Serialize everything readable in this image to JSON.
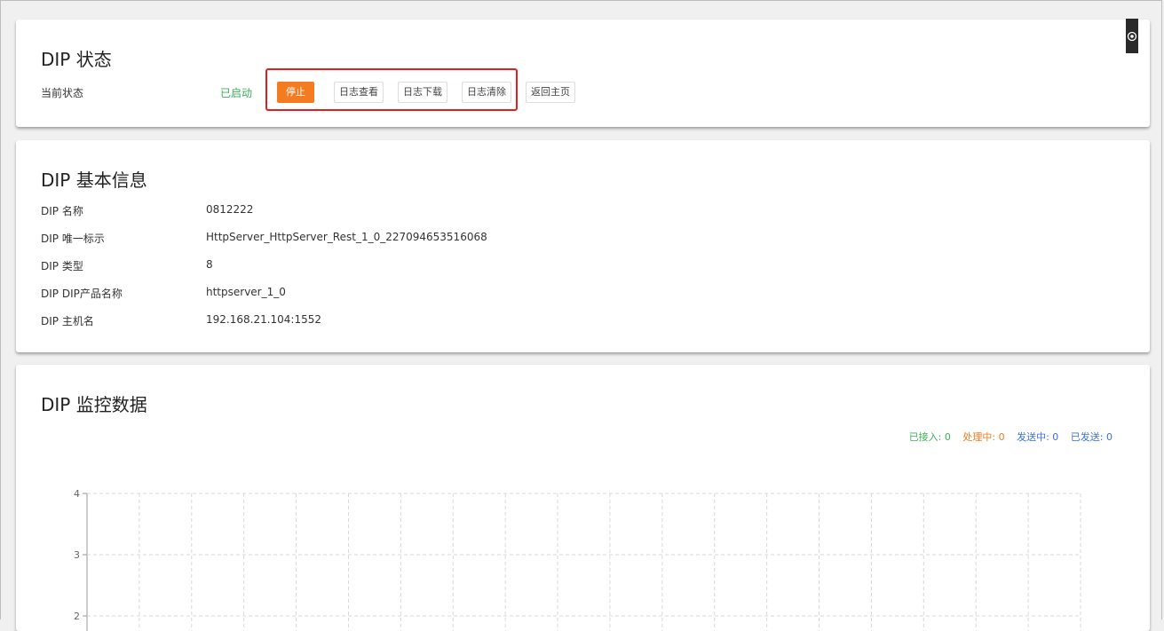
{
  "status_card": {
    "title": "DIP 状态",
    "current_status_label": "当前状态",
    "current_status_value": "已启动",
    "buttons": {
      "stop": "停止",
      "view_log": "日志查看",
      "download_log": "日志下载",
      "clear_log": "日志清除",
      "back_home": "返回主页"
    }
  },
  "info_card": {
    "title": "DIP 基本信息",
    "rows": [
      {
        "label": "DIP 名称",
        "value": "0812222"
      },
      {
        "label": "DIP 唯一标示",
        "value": "HttpServer_HttpServer_Rest_1_0_227094653516068"
      },
      {
        "label": "DIP 类型",
        "value": "8"
      },
      {
        "label": "DIP DIP产品名称",
        "value": "httpserver_1_0"
      },
      {
        "label": "DIP 主机名",
        "value": "192.168.21.104:1552"
      }
    ]
  },
  "monitor_card": {
    "title": "DIP 监控数据",
    "legend": {
      "received": "已接入: 0",
      "processing": "处理中: 0",
      "sending": "发送中: 0",
      "sent": "已发送: 0"
    }
  },
  "colors": {
    "accent": "#f47b20",
    "status_green": "#3eaf5a",
    "legend_blue": "#3a6fd8",
    "highlight_red": "#e02020"
  },
  "icons": {
    "side_tab": "eye-icon"
  },
  "chart_data": {
    "type": "line",
    "y_ticks": [
      "4",
      "3",
      "2"
    ],
    "ylim": [
      2,
      4
    ],
    "grid": true,
    "series": []
  }
}
